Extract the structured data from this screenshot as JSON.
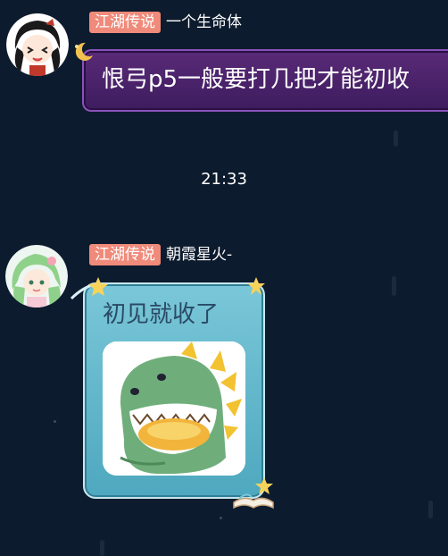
{
  "messages": [
    {
      "badge": "江湖传说",
      "nickname": "一个生命体",
      "text": "恨弓p5一般要打几把才能初收"
    },
    {
      "badge": "江湖传说",
      "nickname": "朝霞星火-",
      "text": "初见就收了",
      "sticker": "green-dinosaur-sticker"
    }
  ],
  "timestamp": "21:33",
  "colors": {
    "background": "#0d1b2e",
    "badge": "#f08a7a",
    "bubble_purple": "#4a2268",
    "bubble_teal": "#62b8cc"
  }
}
